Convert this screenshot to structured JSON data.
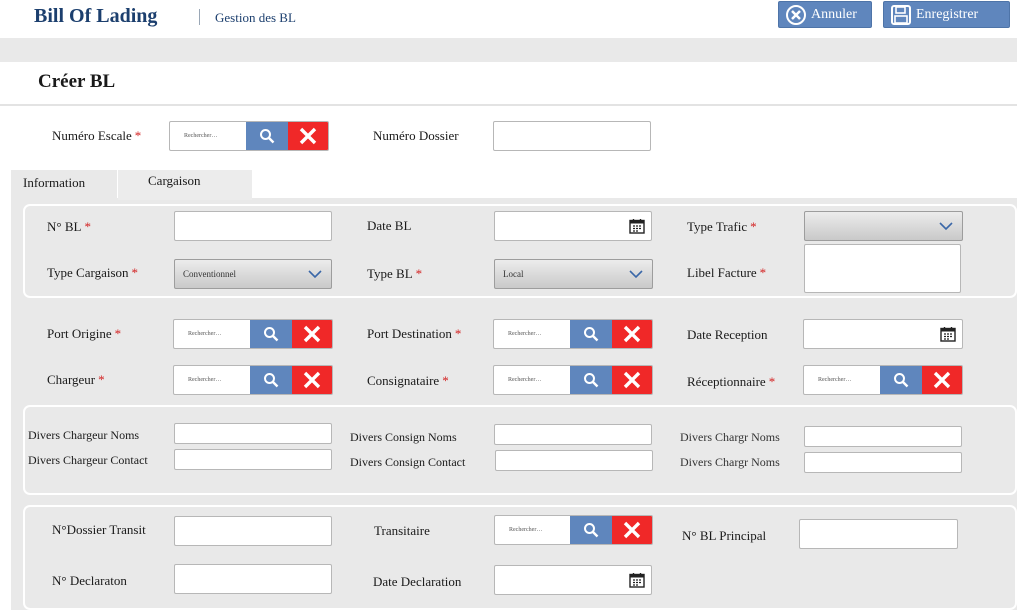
{
  "header": {
    "app_title": "Bill Of Lading",
    "breadcrumb": "Gestion des BL",
    "cancel_label": "Annuler",
    "save_label": "Enregistrer"
  },
  "page": {
    "title": "Créer BL"
  },
  "top_fields": {
    "numero_escale_label": "Numéro Escale",
    "numero_escale_placeholder": "Rechercher…",
    "numero_dossier_label": "Numéro Dossier"
  },
  "tabs": [
    {
      "label": "Information",
      "active": false
    },
    {
      "label": "Cargaison",
      "active": true
    }
  ],
  "section1": {
    "no_bl_label": "N° BL",
    "date_bl_label": "Date BL",
    "type_trafic_label": "Type Trafic",
    "type_trafic_value": "",
    "type_cargaison_label": "Type Cargaison",
    "type_cargaison_value": "Conventionnel",
    "type_bl_label": "Type BL",
    "type_bl_value": "Local",
    "libel_facture_label": "Libel Facture"
  },
  "section2": {
    "port_origine_label": "Port Origine",
    "port_destination_label": "Port Destination",
    "date_reception_label": "Date Reception",
    "chargeur_label": "Chargeur",
    "consignataire_label": "Consignataire",
    "receptionnaire_label": "Réceptionnaire",
    "search_placeholder": "Rechercher…"
  },
  "section3": {
    "divers_chargeur_noms_label": "Divers Chargeur Noms",
    "divers_chargeur_contact_label": "Divers Chargeur Contact",
    "divers_consign_noms_label": "Divers Consign Noms",
    "divers_consign_contact_label": "Divers Consign Contact",
    "divers_chargr_noms_label_1": "Divers Chargr Noms",
    "divers_chargr_noms_label_2": "Divers Chargr Noms"
  },
  "section4": {
    "dossier_transit_label": "N°Dossier Transit",
    "transitaire_label": "Transitaire",
    "transitaire_placeholder": "Rechercher…",
    "bl_principal_label": "N° BL Principal",
    "declaration_no_label": "N° Declaraton",
    "date_declaration_label": "Date Declaration"
  },
  "required_marker": "*",
  "colors": {
    "brand_blue": "#1c3f6e",
    "button_blue": "#5f86bd",
    "clear_red": "#f02828",
    "required_red": "#d32020",
    "panel_grey": "#e9e9e9"
  },
  "icons": [
    "cancel-circle-icon",
    "save-disk-icon",
    "search-icon",
    "clear-x-icon",
    "calendar-icon",
    "chevron-down-icon"
  ]
}
